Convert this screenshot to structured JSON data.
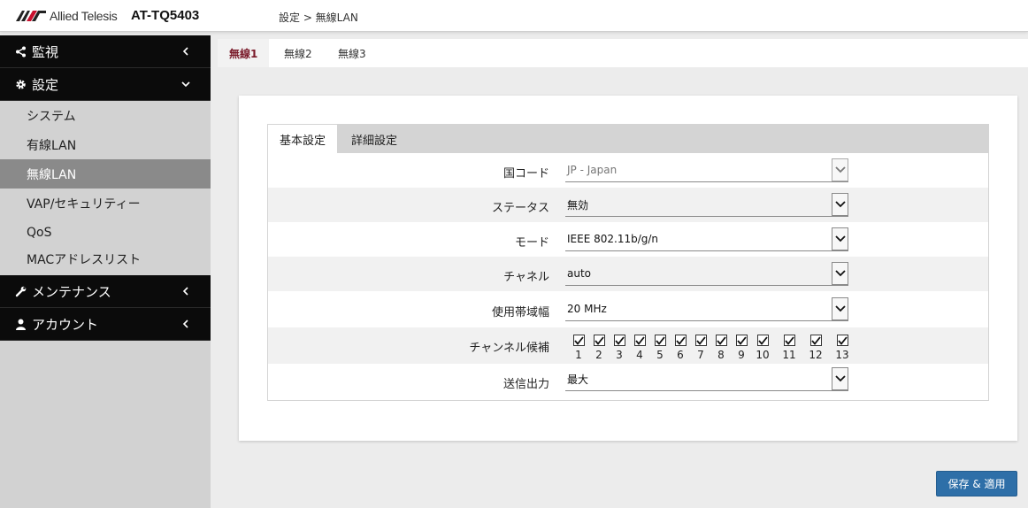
{
  "header": {
    "brand": "Allied Telesis",
    "model": "AT-TQ5403",
    "breadcrumb": "設定 > 無線LAN"
  },
  "sidebar": {
    "items": [
      {
        "label": "監視",
        "icon": "share-icon"
      },
      {
        "label": "設定",
        "icon": "gear-icon"
      },
      {
        "label": "メンテナンス",
        "icon": "wrench-icon"
      },
      {
        "label": "アカウント",
        "icon": "user-icon"
      }
    ],
    "sub_items": [
      "システム",
      "有線LAN",
      "無線LAN",
      "VAP/セキュリティー",
      "QoS",
      "MACアドレスリスト"
    ],
    "active_sub": "無線LAN"
  },
  "radio_tabs": [
    "無線1",
    "無線2",
    "無線3"
  ],
  "settings_tabs": [
    "基本設定",
    "詳細設定"
  ],
  "form": {
    "country": {
      "label": "国コード",
      "value": "JP - Japan"
    },
    "status": {
      "label": "ステータス",
      "value": "無効"
    },
    "mode": {
      "label": "モード",
      "value": "IEEE 802.11b/g/n"
    },
    "channel": {
      "label": "チャネル",
      "value": "auto"
    },
    "bandwidth": {
      "label": "使用帯域幅",
      "value": "20 MHz"
    },
    "channel_candidates": {
      "label": "チャンネル候補",
      "channels": [
        "1",
        "2",
        "3",
        "4",
        "5",
        "6",
        "7",
        "8",
        "9",
        "10",
        "11",
        "12",
        "13"
      ],
      "checked": [
        true,
        true,
        true,
        true,
        true,
        true,
        true,
        true,
        true,
        true,
        true,
        true,
        true
      ]
    },
    "tx_power": {
      "label": "送信出力",
      "value": "最大"
    }
  },
  "save_button": "保存 & 適用",
  "colors": {
    "sidebar_dark": "#0b0b0b",
    "sidebar_bg": "#d2d2d2",
    "active_sub_bg": "#8a8a8a",
    "accent_tab": "#7a1a2a",
    "button": "#2e6fa8"
  }
}
